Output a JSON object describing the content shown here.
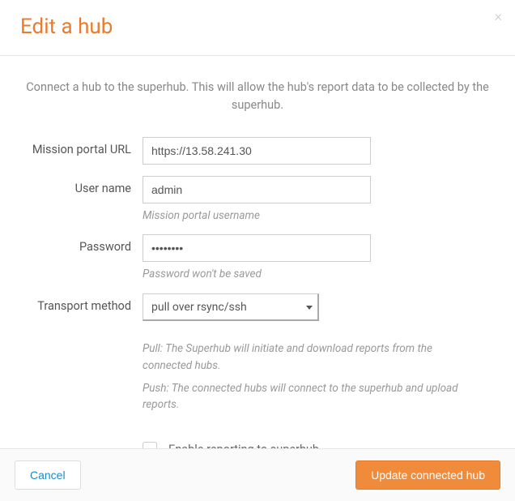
{
  "header": {
    "title": "Edit a hub",
    "close_icon": "×"
  },
  "intro": "Connect a hub to the superhub. This will allow the hub's report data to be collected by the superhub.",
  "form": {
    "url": {
      "label": "Mission portal URL",
      "value": "https://13.58.241.30"
    },
    "username": {
      "label": "User name",
      "value": "admin",
      "help": "Mission portal username"
    },
    "password": {
      "label": "Password",
      "value": "••••••••",
      "help": "Password won't be saved"
    },
    "transport": {
      "label": "Transport method",
      "selected": "pull over rsync/ssh",
      "help_pull": "Pull: The Superhub will initiate and download reports from the connected hubs.",
      "help_push": "Push: The connected hubs will connect to the superhub and upload reports."
    },
    "enable_reporting": {
      "label": "Enable reporting to superhub",
      "checked": false
    }
  },
  "footer": {
    "cancel": "Cancel",
    "submit": "Update connected hub"
  }
}
